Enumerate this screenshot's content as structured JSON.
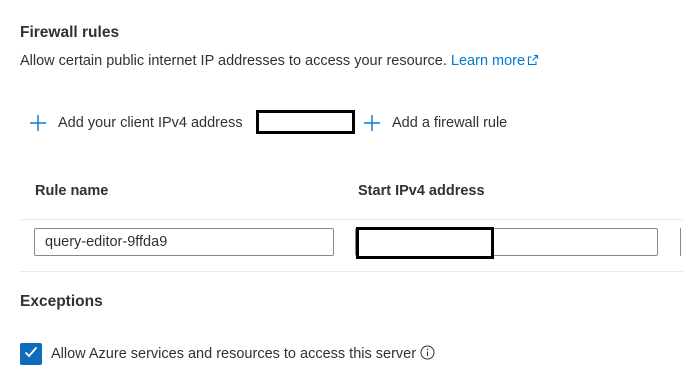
{
  "firewall": {
    "title": "Firewall rules",
    "description": "Allow certain public internet IP addresses to access your resource. ",
    "learn_more": "Learn more",
    "add_client_ip_label": "Add your client IPv4 address",
    "add_rule_label": "Add a firewall rule"
  },
  "table": {
    "columns": [
      "Rule name",
      "Start IPv4 address"
    ],
    "rows": [
      {
        "rule_name": "query-editor-9ffda9",
        "start_ip": ""
      }
    ]
  },
  "exceptions": {
    "title": "Exceptions",
    "allow_azure_label": "Allow Azure services and resources to access this server",
    "allow_azure_checked": true
  },
  "colors": {
    "accent": "#0078d4",
    "checkbox": "#0f6cbd",
    "text": "#323130"
  },
  "icons": {
    "add": "plus-icon",
    "external": "external-link-icon",
    "check": "checkmark-icon",
    "info": "info-icon"
  }
}
